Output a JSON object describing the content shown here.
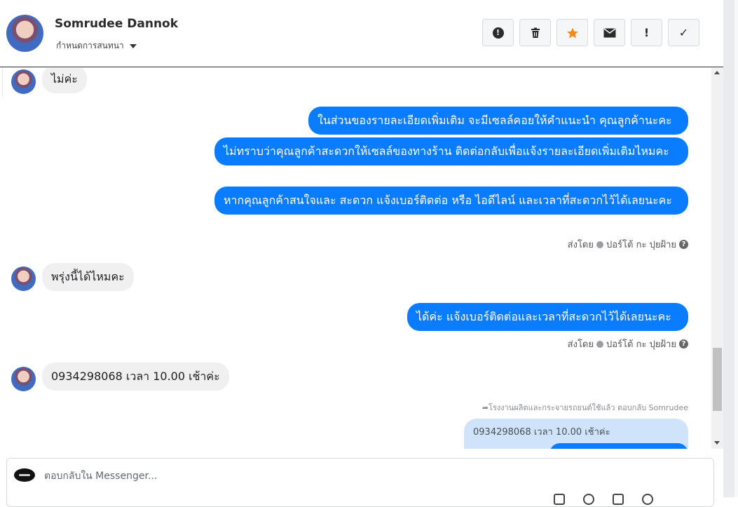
{
  "contact": {
    "name": "Somrudee Dannok",
    "assign_label": "กำหนดการสนทนา"
  },
  "actions": [
    {
      "name": "spam-button",
      "icon": "alert-circle-icon"
    },
    {
      "name": "delete-button",
      "icon": "trash-icon"
    },
    {
      "name": "star-button",
      "icon": "star-icon",
      "color": "#f08a1c"
    },
    {
      "name": "mark-unread-button",
      "icon": "envelope-icon"
    },
    {
      "name": "follow-up-button",
      "icon": "exclamation-icon",
      "glyph": "!"
    },
    {
      "name": "mark-done-button",
      "icon": "check-icon",
      "glyph": "✓"
    }
  ],
  "messages": [
    {
      "from": "customer",
      "text": "ไม่ค่ะ"
    },
    {
      "from": "page",
      "text": "ในส่วนของรายละเอียดเพิ่มเติม จะมีเซลล์คอยให้คำแนะนำ คุณลูกค้านะคะ"
    },
    {
      "from": "page",
      "text": "ไม่ทราบว่าคุณลูกค้าสะดวกให้เซลล์ของทางร้าน ติดต่อกลับเพื่อแจ้งรายละเอียดเพิ่มเติมไหมคะ"
    },
    {
      "from": "page",
      "text": "หากคุณลูกค้าสนใจและ สะดวก แจ้งเบอร์ติดต่อ หรือ ไอดีไลน์ และเวลาที่สะดวกไว้ได้เลยนะคะ"
    },
    {
      "from": "customer",
      "text": "พรุ่งนี้ได้ไหมคะ"
    },
    {
      "from": "page",
      "text": "ได้ค่ะ แจ้งเบอร์ติดต่อและเวลาที่สะดวกไว้ได้เลยนะคะ"
    },
    {
      "from": "customer",
      "text": "0934298068 เวลา 10.00 เช้าค่ะ"
    }
  ],
  "sent_by": {
    "prefix": "ส่งโดย",
    "agent": "ปอร์โต้ กะ ปุยฝ้าย",
    "help": "?"
  },
  "reply": {
    "note": "โรงงานผลิตและกระจายรถยนต์ใช้แล้ว ตอบกลับ Somrudee",
    "quoted": "0934298068 เวลา 10.00 เช้าค่ะ"
  },
  "composer": {
    "placeholder": "ตอบกลับใน Messenger..."
  },
  "colors": {
    "page_bubble": "#0a7cff",
    "customer_bubble": "#f0f0f0"
  }
}
